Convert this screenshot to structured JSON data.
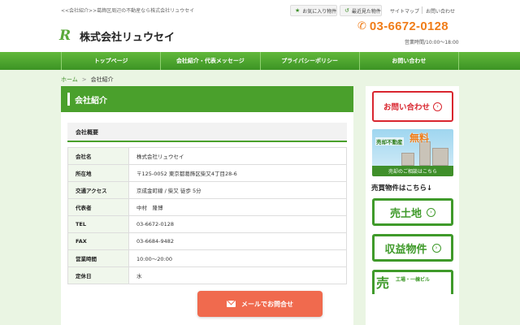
{
  "header": {
    "tagline": "<<会社紹介>>葛飾区周辺の不動産なら株式会社リュウセイ",
    "logo_mark": "R",
    "logo_text": "株式会社リュウセイ",
    "favorites_label": "お気に入り物件",
    "recent_label": "最近見た物件",
    "sitemap_label": "サイトマップ",
    "contact_link_label": "お問い合わせ",
    "phone": "03-6672-0128",
    "hours": "営業時間/10:00～18:00"
  },
  "nav": {
    "items": [
      {
        "label": "トップページ"
      },
      {
        "label": "会社紹介・代表メッセージ"
      },
      {
        "label": "プライバシーポリシー"
      },
      {
        "label": "お問い合わせ"
      }
    ]
  },
  "breadcrumb": {
    "home": "ホーム",
    "separator": ">",
    "current": "会社紹介"
  },
  "main": {
    "title": "会社紹介",
    "section_title": "会社概要",
    "rows": [
      {
        "label": "会社名",
        "value": "株式会社リュウセイ"
      },
      {
        "label": "所在地",
        "value": "〒125-0052 東京都葛飾区柴又4丁目28-6"
      },
      {
        "label": "交通アクセス",
        "value": "京成金町線 / 柴又 徒歩 5分"
      },
      {
        "label": "代表者",
        "value": "中村　隆博"
      },
      {
        "label": "TEL",
        "value": "03-6672-0128"
      },
      {
        "label": "FAX",
        "value": "03-6684-9482"
      },
      {
        "label": "営業時間",
        "value": "10:00～20:00"
      },
      {
        "label": "定休日",
        "value": "水"
      }
    ]
  },
  "sidebar": {
    "contact_label": "お問い合わせ",
    "banner_line1": "売却不動産",
    "banner_free": "無料",
    "banner_bar": "売却のご相談はこちら",
    "properties_title": "売買物件はこちら↓",
    "cat1": "売土地",
    "cat2": "収益物件",
    "cat3_big": "売",
    "cat3_small": "工場・一棟ビル"
  },
  "floating": {
    "mail_label": "メールでお問合せ"
  },
  "colors": {
    "brand_green": "#4aa02c",
    "phone_orange": "#f07d19",
    "contact_red": "#d9262f",
    "mail_button": "#f06a4e"
  }
}
